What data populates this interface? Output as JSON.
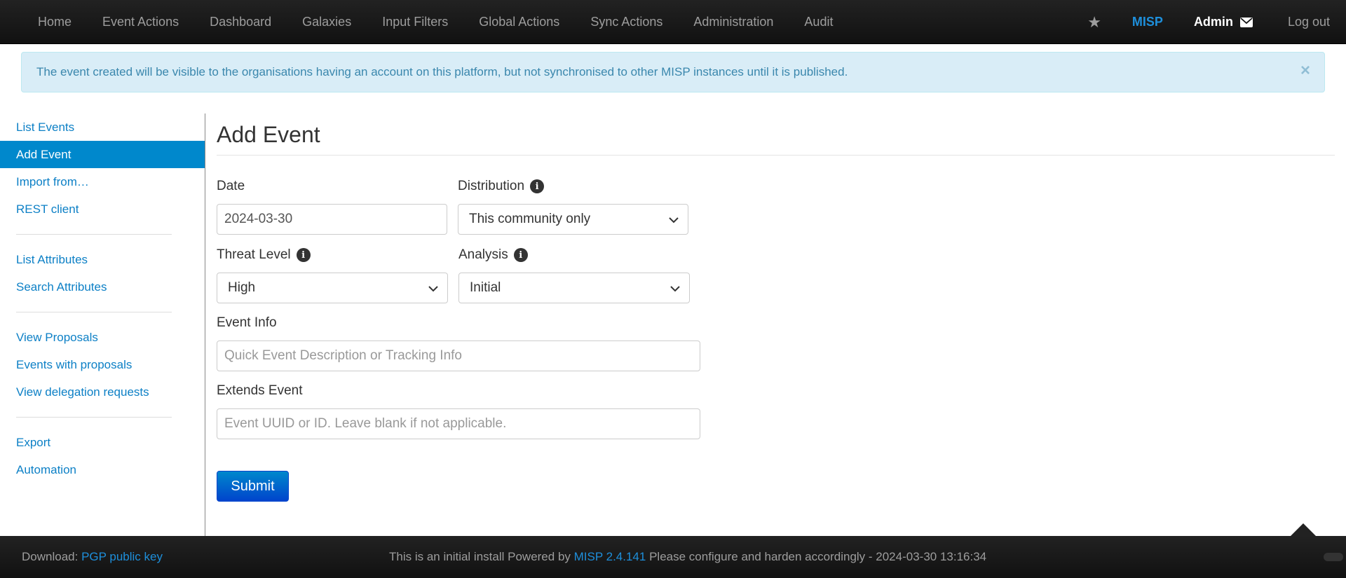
{
  "nav": {
    "items": [
      "Home",
      "Event Actions",
      "Dashboard",
      "Galaxies",
      "Input Filters",
      "Global Actions",
      "Sync Actions",
      "Administration",
      "Audit"
    ],
    "org": "MISP",
    "user": "Admin",
    "logout": "Log out"
  },
  "alert": {
    "message": "The event created will be visible to the organisations having an account on this platform, but not synchronised to other MISP instances until it is published.",
    "close": "×"
  },
  "sidebar": {
    "group1": [
      "List Events",
      "Add Event",
      "Import from…",
      "REST client"
    ],
    "group2": [
      "List Attributes",
      "Search Attributes"
    ],
    "group3": [
      "View Proposals",
      "Events with proposals",
      "View delegation requests"
    ],
    "group4": [
      "Export",
      "Automation"
    ],
    "active": "Add Event"
  },
  "form": {
    "title": "Add Event",
    "date_label": "Date",
    "date_value": "2024-03-30",
    "distribution_label": "Distribution",
    "distribution_value": "This community only",
    "threat_label": "Threat Level",
    "threat_value": "High",
    "analysis_label": "Analysis",
    "analysis_value": "Initial",
    "info_label": "Event Info",
    "info_placeholder": "Quick Event Description or Tracking Info",
    "extends_label": "Extends Event",
    "extends_placeholder": "Event UUID or ID. Leave blank if not applicable.",
    "submit": "Submit"
  },
  "footer": {
    "download_label": "Download:",
    "pgp_link": "PGP public key",
    "install_text": "This is an initial install Powered by",
    "version_link": "MISP 2.4.141",
    "harden_text": "Please configure and harden accordingly - 2024-03-30 13:16:34"
  },
  "colors": {
    "accent": "#0088cc",
    "link": "#0d80c6",
    "alert_bg": "#d9edf7"
  }
}
